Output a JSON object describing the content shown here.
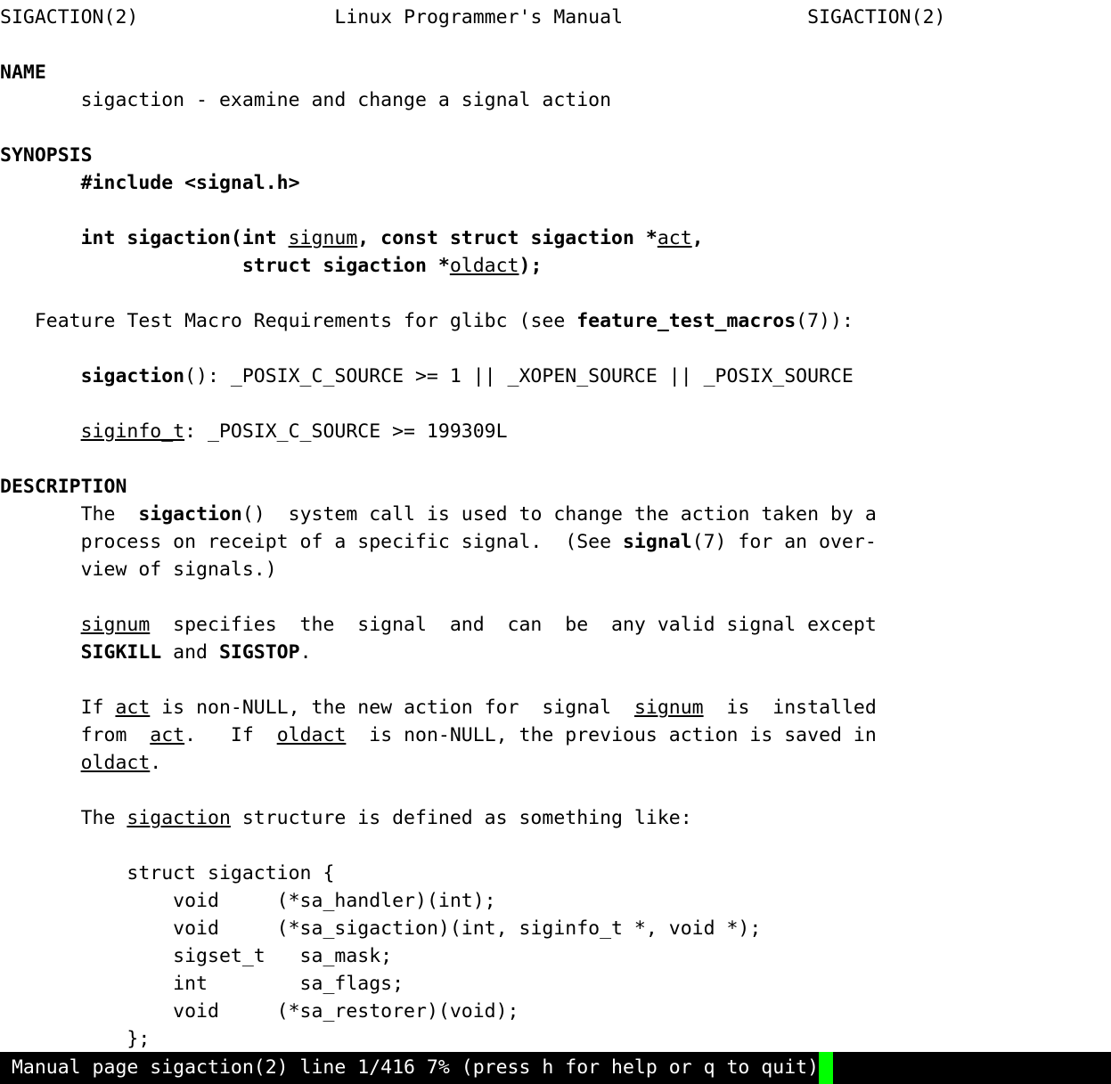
{
  "terminal": {
    "background_color": "#ffffff",
    "foreground_color": "#000000",
    "status_background_color": "#000000",
    "status_foreground_color": "#ffffff",
    "cursor_color": "#00ff00"
  },
  "manpage": {
    "header": {
      "left": "SIGACTION(2)",
      "center": "Linux Programmer's Manual",
      "right": "SIGACTION(2)"
    },
    "sections": [
      {
        "heading": "NAME"
      },
      {
        "heading": "SYNOPSIS"
      },
      {
        "heading": "DESCRIPTION"
      }
    ],
    "lines": [
      {
        "id": "header-line",
        "text": "SIGACTION(2)                 Linux Programmer's Manual                SIGACTION(2)"
      },
      {
        "id": "blank-1",
        "text": ""
      },
      {
        "id": "heading-name",
        "text": "NAME"
      },
      {
        "id": "name-body",
        "text": "       sigaction - examine and change a signal action"
      },
      {
        "id": "blank-2",
        "text": ""
      },
      {
        "id": "heading-synopsis",
        "text": "SYNOPSIS"
      },
      {
        "id": "synopsis-include",
        "text": "       #include <signal.h>"
      },
      {
        "id": "blank-3",
        "text": ""
      },
      {
        "id": "synopsis-proto-1",
        "text": "       int sigaction(int signum, const struct sigaction *act,"
      },
      {
        "id": "synopsis-proto-2",
        "text": "                     struct sigaction *oldact);"
      },
      {
        "id": "blank-4",
        "text": ""
      },
      {
        "id": "ftm-intro",
        "text": "   Feature Test Macro Requirements for glibc (see feature_test_macros(7)):"
      },
      {
        "id": "blank-5",
        "text": ""
      },
      {
        "id": "ftm-sigaction",
        "text": "       sigaction(): _POSIX_C_SOURCE >= 1 || _XOPEN_SOURCE || _POSIX_SOURCE"
      },
      {
        "id": "blank-6",
        "text": ""
      },
      {
        "id": "ftm-siginfo",
        "text": "       siginfo_t: _POSIX_C_SOURCE >= 199309L"
      },
      {
        "id": "blank-7",
        "text": ""
      },
      {
        "id": "heading-description",
        "text": "DESCRIPTION"
      },
      {
        "id": "desc-p1-l1",
        "text": "       The  sigaction()  system call is used to change the action taken by a"
      },
      {
        "id": "desc-p1-l2",
        "text": "       process on receipt of a specific signal.  (See signal(7) for an over-"
      },
      {
        "id": "desc-p1-l3",
        "text": "       view of signals.)"
      },
      {
        "id": "blank-8",
        "text": ""
      },
      {
        "id": "desc-p2-l1",
        "text": "       signum  specifies  the  signal  and  can  be  any valid signal except"
      },
      {
        "id": "desc-p2-l2",
        "text": "       SIGKILL and SIGSTOP."
      },
      {
        "id": "blank-9",
        "text": ""
      },
      {
        "id": "desc-p3-l1",
        "text": "       If act is non-NULL, the new action for  signal  signum  is  installed"
      },
      {
        "id": "desc-p3-l2",
        "text": "       from  act.   If  oldact  is non-NULL, the previous action is saved in"
      },
      {
        "id": "desc-p3-l3",
        "text": "       oldact."
      },
      {
        "id": "blank-10",
        "text": ""
      },
      {
        "id": "desc-p4-l1",
        "text": "       The sigaction structure is defined as something like:"
      },
      {
        "id": "blank-11",
        "text": ""
      },
      {
        "id": "struct-l1",
        "text": "           struct sigaction {"
      },
      {
        "id": "struct-l2",
        "text": "               void     (*sa_handler)(int);"
      },
      {
        "id": "struct-l3",
        "text": "               void     (*sa_sigaction)(int, siginfo_t *, void *);"
      },
      {
        "id": "struct-l4",
        "text": "               sigset_t   sa_mask;"
      },
      {
        "id": "struct-l5",
        "text": "               int        sa_flags;"
      },
      {
        "id": "struct-l6",
        "text": "               void     (*sa_restorer)(void);"
      },
      {
        "id": "struct-l7",
        "text": "           };"
      }
    ],
    "segments": {
      "header_left": "SIGACTION(2)",
      "header_center_pad": "                 ",
      "header_center": "Linux Programmer's Manual",
      "header_right_pad": "                ",
      "header_right": "SIGACTION(2)",
      "name_heading": "NAME",
      "name_indent": "       ",
      "name_body": "sigaction - examine and change a signal action",
      "synopsis_heading": "SYNOPSIS",
      "synopsis_include": "#include <signal.h>",
      "proto_int_sigaction": "int sigaction(int ",
      "proto_signum": "signum",
      "proto_after_signum": ", const struct sigaction *",
      "proto_act": "act",
      "proto_comma": ",",
      "proto_line2_indent": "                     ",
      "proto_struct_sigaction": "struct sigaction *",
      "proto_oldact": "oldact",
      "proto_end": ");",
      "ftm_indent": "   ",
      "ftm_text_pre": "Feature Test Macro Requirements for glibc (see ",
      "ftm_bold": "feature_test_macros",
      "ftm_text_post": "(7)):",
      "ftm_sigaction_bold": "sigaction",
      "ftm_sigaction_rest": "(): _POSIX_C_SOURCE >= 1 || _XOPEN_SOURCE || _POSIX_SOURCE",
      "ftm_siginfo_u": "siginfo_t",
      "ftm_siginfo_rest": ": _POSIX_C_SOURCE >= 199309L",
      "description_heading": "DESCRIPTION",
      "desc1_a": "The  ",
      "desc1_b": "sigaction",
      "desc1_c": "()  system call is used to change the action taken by a",
      "desc2_a": "process on receipt of a specific signal.  (See ",
      "desc2_b": "signal",
      "desc2_c": "(7) for an over-",
      "desc3": "view of signals.)",
      "p2_signum": "signum",
      "p2_mid": "  specifies  the  signal  and  can  be  any valid signal except",
      "p2_sigkill": "SIGKILL",
      "p2_and": " and ",
      "p2_sigstop": "SIGSTOP",
      "p2_period": ".",
      "p3_if": "If ",
      "p3_act": "act",
      "p3_mid": " is non-NULL, the new action for  signal  ",
      "p3_signum": "signum",
      "p3_end": "  is  installed",
      "p3_from": "from  ",
      "p3_act2": "act",
      "p3_dotif": ".   If  ",
      "p3_oldact": "oldact",
      "p3_tail": "  is non-NULL, the previous action is saved in",
      "p3_oldact2": "oldact",
      "p3_dot": ".",
      "p4_the": "The ",
      "p4_sigaction": "sigaction",
      "p4_rest": " structure is defined as something like:",
      "struct_indent": "           ",
      "struct_open": "struct sigaction {",
      "struct_member_indent": "               ",
      "struct_m1": "void     (*sa_handler)(int);",
      "struct_m2": "void     (*sa_sigaction)(int, siginfo_t *, void *);",
      "struct_m3": "sigset_t   sa_mask;",
      "struct_m4": "int        sa_flags;",
      "struct_m5": "void     (*sa_restorer)(void);",
      "struct_close": "};"
    }
  },
  "status_bar": {
    "text": " Manual page sigaction(2) line 1/416 7% (press h for help or q to quit)",
    "page_name": "sigaction(2)",
    "line_position": "1/416",
    "percent": "7%",
    "hint": "(press h for help or q to quit)",
    "cursor": "block-cursor"
  }
}
